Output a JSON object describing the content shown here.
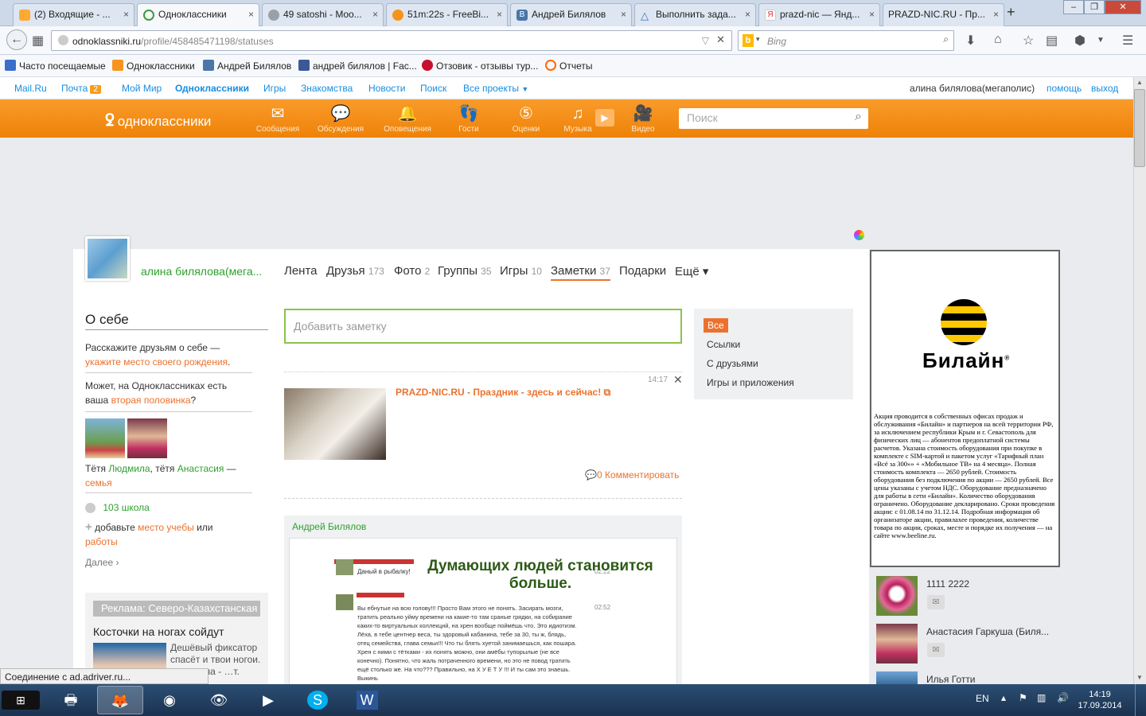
{
  "tabs": [
    {
      "label": "(2) Входящие - ...",
      "color": "#ffa930"
    },
    {
      "label": "Одноклассники",
      "color": "#3a9b3a"
    },
    {
      "label": "49 satoshi - Moo...",
      "color": "#9aa0a8"
    },
    {
      "label": "51m:22s - FreeBi...",
      "color": "#f7931a"
    },
    {
      "label": "Андрей Билялов",
      "color": "#4a76a8"
    },
    {
      "label": "Выполнить зада...",
      "color": "#3a6fc9"
    },
    {
      "label": "prazd-nic — Янд...",
      "color": "#e62e2e"
    },
    {
      "label": "PRAZD-NIC.RU - Пр...",
      "color": "#ffffff"
    }
  ],
  "browser": {
    "url_host": "odnoklassniki.ru",
    "url_path": "/profile/458485471198/statuses",
    "search_placeholder": "Bing"
  },
  "bookmarks": [
    {
      "label": "Часто посещаемые",
      "color": "#3a6fc9"
    },
    {
      "label": "Одноклассники",
      "color": "#f7931e"
    },
    {
      "label": "Андрей Билялов",
      "color": "#4a76a8"
    },
    {
      "label": "андрей билялов | Fac...",
      "color": "#3b5998"
    },
    {
      "label": "Отзовик - отзывы тур...",
      "color": "#c8102e"
    },
    {
      "label": "Отчеты",
      "color": "#ff6a00"
    }
  ],
  "portal": {
    "links": [
      "Mail.Ru",
      "Почта",
      "Мой Мир",
      "Одноклассники",
      "Игры",
      "Знакомства",
      "Новости",
      "Поиск",
      "Все проекты"
    ],
    "mail_count": "2",
    "user": "алина билялова(мегаполис)",
    "help": "помощь",
    "logout": "выход"
  },
  "ok": {
    "logo": "одноклассники",
    "nav": [
      "Сообщения",
      "Обсуждения",
      "Оповещения",
      "Гости",
      "Оценки",
      "Музыка",
      "Видео"
    ],
    "search_placeholder": "Поиск"
  },
  "profile": {
    "name": "алина билялова(мега...",
    "tabs": [
      {
        "label": "Лента",
        "count": ""
      },
      {
        "label": "Друзья",
        "count": "173"
      },
      {
        "label": "Фото",
        "count": "2"
      },
      {
        "label": "Группы",
        "count": "35"
      },
      {
        "label": "Игры",
        "count": "10"
      },
      {
        "label": "Заметки",
        "count": "37"
      },
      {
        "label": "Подарки",
        "count": ""
      },
      {
        "label": "Ещё ▾",
        "count": ""
      }
    ]
  },
  "about": {
    "title": "О себе",
    "tell_text": "Расскажите друзьям о себе —",
    "tell_link": "укажите место своего рождения",
    "half_text1": "Может, на Одноклассниках есть",
    "half_text2": "ваша",
    "half_link": "вторая половинка",
    "family_prefix": "Тётя",
    "family_name1": "Людмила",
    "family_mid": ", тётя",
    "family_name2": "Анастасия",
    "family_dash": "—",
    "family_link": "семья",
    "school": "103 школа",
    "add_prefix": "добавьте",
    "add_link1": "место учебы",
    "add_or": "или",
    "add_link2": "работы",
    "more": "Далее ›"
  },
  "sidead": {
    "header": "Реклама: Северо-Казахстанская",
    "title": "Косточки на ногах сойдут",
    "text": "Дешёвый фиксатор спасёт и твои ногои. …игинала - …т. Успей"
  },
  "feed": {
    "add_note_placeholder": "Добавить заметку",
    "post1": {
      "time": "14:17",
      "title": "PRAZD-NIC.RU - Праздник - здесь и сейчас!",
      "comments": "0 Комментировать"
    },
    "post2": {
      "author": "Андрей Билялов",
      "caption_line1": "Думающих людей становится",
      "caption_line2": "больше.",
      "chat_line1": "Даный в рыбалку!",
      "chat_time1": "02:22",
      "chat_time2": "02:52",
      "chat_text": "Вы ебнутые на всю голову!!! Просто Вам этого не понять. Засирать мозги, тратить реально уйму времени на какие-то там сраные грядки, на собирание каких-то виртуальных коллекций, на хрен вообще поймёшь что. Это идиотизм. Лёха, в тебе центнер веса, ты здоровый кабанина, тебе за 30, ты ж, блядь, отец семейства, глава семьи!!! Что ты блять хуетой занимаешься, как пошара. Хрен с ними с тётками - их понять можно, они амёбы тупорылые (не все конечно). Понятно, что жаль потраченного времени, но это не повод тратить ещё столько же. На что??? Правильно, на Х У Е Т У !!! И ты сам это знаешь. Выкинь"
    }
  },
  "filter": [
    "Все",
    "Ссылки",
    "С друзьями",
    "Игры и приложения"
  ],
  "beeline_ad": {
    "brand": "Билайн",
    "text": "Акция проводится в собственных офисах продаж и обслуживания «Билайн» и партнеров на всей территории РФ, за исключением республики Крым и г. Севастополь для физических лиц — абонентов предоплатной системы расчетов. Указана стоимость оборудования при покупке в комплекте с SIM-картой и пакетом услуг «Тарифный план «Всё за 300»» + «Мобильное ТВ» на 4 месяца». Полная стоимость комплекта — 2650 рублей. Стоимость оборудования без подключения по акции — 2650 рублей. Все цены указаны с учетом НДС. Оборудование предназначено для работы в сети «Билайн». Количество оборудования ограничено. Оборудование декларировано. Сроки проведения акции: с 01.08.14 по 31.12.14. Подробная информация об организаторе акции, правилахее проведения, количестве товара по акции, сроках, месте и порядке их получения — на сайте www.beeline.ru."
  },
  "friends": [
    "1111 2222",
    "Анастасия Гаркуша (Биля...",
    "Илья Готти"
  ],
  "statusbar": "Соединение с ad.adriver.ru...",
  "taskbar": {
    "lang": "EN",
    "time": "14:19",
    "date": "17.09.2014"
  }
}
